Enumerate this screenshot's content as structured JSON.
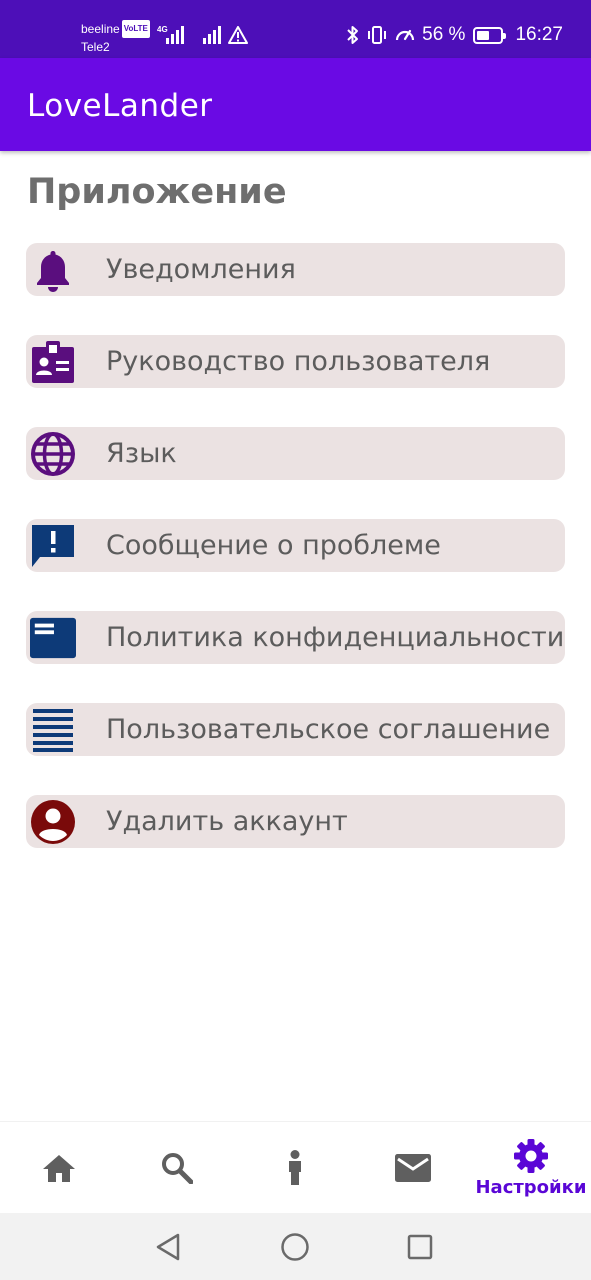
{
  "status_bar": {
    "carrier1": "beeline",
    "volte": "VoLTE",
    "carrier2": "Tele2",
    "net_type": "4G",
    "battery_percent": "56 %",
    "battery_level": 0.56,
    "time": "16:27"
  },
  "app_bar": {
    "title": "LoveLander"
  },
  "section": {
    "title": "Приложение"
  },
  "menu": {
    "items": [
      {
        "label": "Уведомления",
        "icon": "bell-icon",
        "color": "#5a0e7e"
      },
      {
        "label": "Руководство пользователя",
        "icon": "id-badge-icon",
        "color": "#5a0e7e"
      },
      {
        "label": "Язык",
        "icon": "globe-icon",
        "color": "#5a0e7e"
      },
      {
        "label": "Сообщение о проблеме",
        "icon": "report-message-icon",
        "color": "#0d3a78"
      },
      {
        "label": "Политика конфиденциальности",
        "icon": "policy-card-icon",
        "color": "#0d3a78"
      },
      {
        "label": "Пользовательское соглашение",
        "icon": "agreement-lines-icon",
        "color": "#0d3a78"
      },
      {
        "label": "Удалить аккаунт",
        "icon": "account-circle-icon",
        "color": "#7a0a0a"
      }
    ]
  },
  "bottom_nav": {
    "items": [
      {
        "icon": "home-icon"
      },
      {
        "icon": "search-icon"
      },
      {
        "icon": "person-icon"
      },
      {
        "icon": "mail-icon"
      },
      {
        "icon": "gear-icon",
        "label": "Настройки",
        "active": true
      }
    ],
    "active_color": "#5a06d6",
    "inactive_color": "#5f5f5f"
  },
  "colors": {
    "status_bar": "#4d0fb8",
    "app_bar": "#6a0ae4",
    "menu_item_bg": "#ebe2e2"
  }
}
